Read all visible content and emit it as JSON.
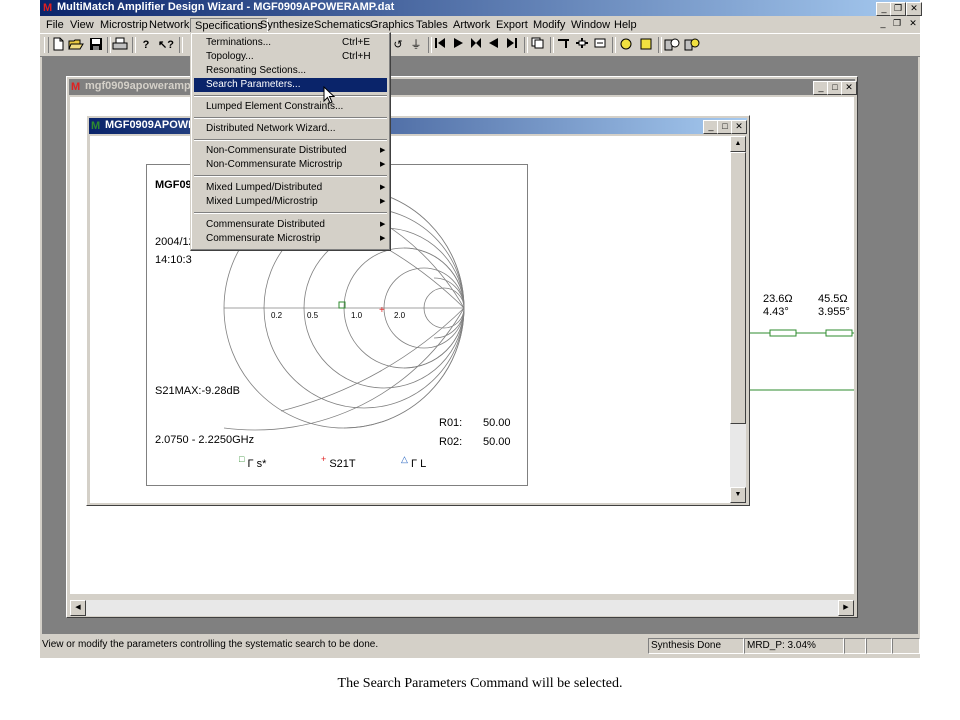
{
  "app": {
    "title": "MultiMatch Amplifier Design Wizard - MGF0909APOWERAMP.dat",
    "icon_letter": "M"
  },
  "menubar": [
    "File",
    "View",
    "Microstrip",
    "Network",
    "Specifications",
    "Synthesize",
    "Schematics",
    "Graphics",
    "Tables",
    "Artwork",
    "Export",
    "Modify",
    "Window",
    "Help"
  ],
  "toolbar_icons": [
    "new-file-icon",
    "open-folder-icon",
    "save-disk-icon",
    "print-icon",
    "help-icon",
    "context-help-icon"
  ],
  "toolbar_right_icons": [
    "rotate-icon",
    "ground-icon",
    "start-bracket-icon",
    "play-right-icon",
    "bowtie-icon",
    "play-left-icon",
    "end-bracket-icon",
    "copy-icon",
    "tee-icon",
    "cross-icon",
    "box-icon",
    "circle-icon",
    "square-icon",
    "zoom-in-icon",
    "zoom-out-icon"
  ],
  "window1": {
    "title": "mgf0909apoweramp.dat"
  },
  "window2": {
    "title": "MGF0909APOWERAMP.dat",
    "chart": {
      "title_fragment": "MGF090",
      "date_fragment": "2004/12",
      "time_fragment": "14:10:3",
      "axis_labels": [
        "0.2",
        "0.5",
        "1.0",
        "2.0"
      ],
      "s21max": "S21MAX:-9.28dB",
      "freq_range": "2.0750 - 2.2250GHz",
      "r01_label": "R01:",
      "r01_value": "50.00",
      "r02_label": "R02:",
      "r02_value": "50.00",
      "legend": [
        {
          "symbol": "□",
          "label": "Γ s*",
          "color": "#2e8b2e"
        },
        {
          "symbol": "+",
          "label": "S21T",
          "color": "#e02020"
        },
        {
          "symbol": "△",
          "label": "Γ L",
          "color": "#1f5fbf"
        }
      ]
    }
  },
  "schematic": {
    "elements": [
      {
        "impedance": "23.6Ω",
        "angle": "4.43°"
      },
      {
        "impedance": "45.5Ω",
        "angle": "3.955°"
      }
    ]
  },
  "dropdown": {
    "items": [
      {
        "label": "Terminations...",
        "shortcut": "Ctrl+E"
      },
      {
        "label": "Topology...",
        "shortcut": "Ctrl+H"
      },
      {
        "label": "Resonating Sections..."
      },
      {
        "label": "Search Parameters...",
        "highlighted": true
      },
      {
        "label": "Lumped Element Constraints..."
      },
      {
        "label": "Distributed Network Wizard..."
      },
      {
        "label": "Non-Commensurate Distributed",
        "submenu": true
      },
      {
        "label": "Non-Commensurate Microstrip",
        "submenu": true
      },
      {
        "label": "Mixed Lumped/Distributed",
        "submenu": true
      },
      {
        "label": "Mixed Lumped/Microstrip",
        "submenu": true
      },
      {
        "label": "Commensurate Distributed",
        "submenu": true
      },
      {
        "label": "Commensurate Microstrip",
        "submenu": true
      }
    ]
  },
  "statusbar": {
    "message": "View or modify the parameters controlling the systematic search to be done.",
    "status": "Synthesis Done",
    "mrd": "MRD_P:  3.04%"
  },
  "caption": "The Search Parameters Command will be selected."
}
